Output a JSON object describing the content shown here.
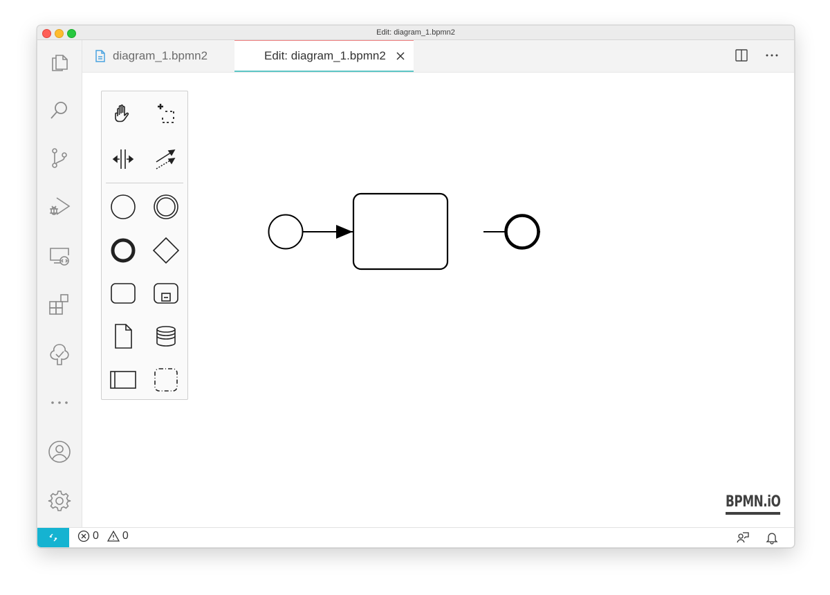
{
  "window": {
    "title": "Edit: diagram_1.bpmn2"
  },
  "activity_bar": {
    "items": [
      "explorer-icon",
      "search-icon",
      "source-control-icon",
      "run-debug-icon",
      "remote-explorer-icon",
      "extensions-icon",
      "testing-icon",
      "more-icon"
    ],
    "bottom_items": [
      "account-icon",
      "settings-gear-icon"
    ]
  },
  "tabs": [
    {
      "label": "diagram_1.bpmn2",
      "active": false,
      "icon": "file-icon"
    },
    {
      "label": "Edit: diagram_1.bpmn2",
      "active": true,
      "icon": "close-icon"
    }
  ],
  "editor_actions": [
    "split-editor-icon",
    "more-actions-icon"
  ],
  "palette": {
    "tools": [
      "hand-tool-icon",
      "lasso-tool-icon",
      "space-tool-icon",
      "global-connect-tool-icon",
      "start-event-icon",
      "intermediate-event-icon",
      "end-event-icon",
      "gateway-icon",
      "task-icon",
      "subprocess-icon",
      "data-object-icon",
      "data-store-icon",
      "participant-pool-icon",
      "group-icon"
    ]
  },
  "diagram": {
    "elements": [
      "start-event",
      "task",
      "end-event"
    ],
    "flows": [
      "sequence-flow-1",
      "sequence-flow-2"
    ]
  },
  "logo": "BPMN.iO",
  "status": {
    "errors": "0",
    "warnings": "0",
    "accent_color": "#15b3d1"
  },
  "colors": {
    "active_tab_top": "#f08080",
    "active_tab_bottom": "#5cc6c6"
  }
}
